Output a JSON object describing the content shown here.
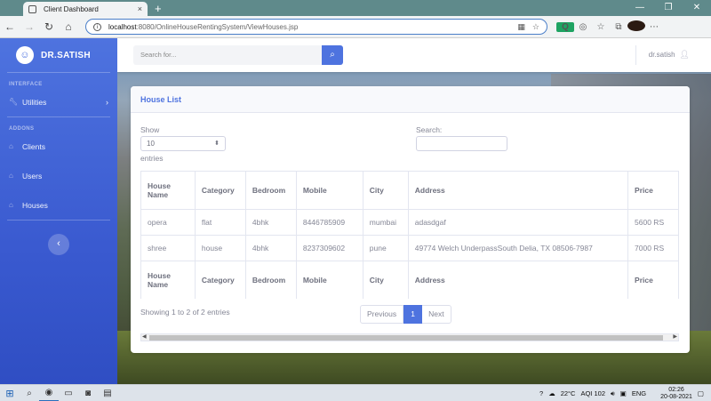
{
  "browser": {
    "tab_title": "Client Dashboard",
    "url_host": "localhost",
    "url_path": ":8080/OnlineHouseRentingSystem/ViewHouses.jsp",
    "new_tab": "+",
    "tab_close": "×",
    "ext_label": "Q"
  },
  "sidebar": {
    "brand": "DR.SATISH",
    "heading_interface": "INTERFACE",
    "heading_addons": "ADDONS",
    "items": [
      {
        "label": "Utilities",
        "icon": "wrench-icon"
      },
      {
        "label": "Clients",
        "icon": "home-icon"
      },
      {
        "label": "Users",
        "icon": "home-icon"
      },
      {
        "label": "Houses",
        "icon": "home-icon"
      }
    ],
    "toggle": "‹"
  },
  "topbar": {
    "search_placeholder": "Search for...",
    "user_name": "dr.satish"
  },
  "card": {
    "title": "House List",
    "show_label": "Show",
    "page_length": "10",
    "entries_label": "entries",
    "search_label": "Search:",
    "columns": [
      "House Name",
      "Category",
      "Bedroom",
      "Mobile",
      "City",
      "Address",
      "Price"
    ],
    "rows": [
      [
        "opera",
        "flat",
        "4bhk",
        "8446785909",
        "mumbai",
        "adasdgaf",
        "5600 RS"
      ],
      [
        "shree",
        "house",
        "4bhk",
        "8237309602",
        "pune",
        "49774 Welch UnderpassSouth Delia, TX 08506-7987",
        "7000 RS"
      ]
    ],
    "info": "Showing 1 to 2 of 2 entries",
    "pagination": {
      "previous": "Previous",
      "current": "1",
      "next": "Next"
    }
  },
  "taskbar": {
    "temperature": "22°C",
    "aqi": "AQI 102",
    "language": "ENG",
    "time": "02:26",
    "date": "20-08-2021"
  },
  "colors": {
    "accent": "#4e73df",
    "text_muted": "#858796"
  }
}
